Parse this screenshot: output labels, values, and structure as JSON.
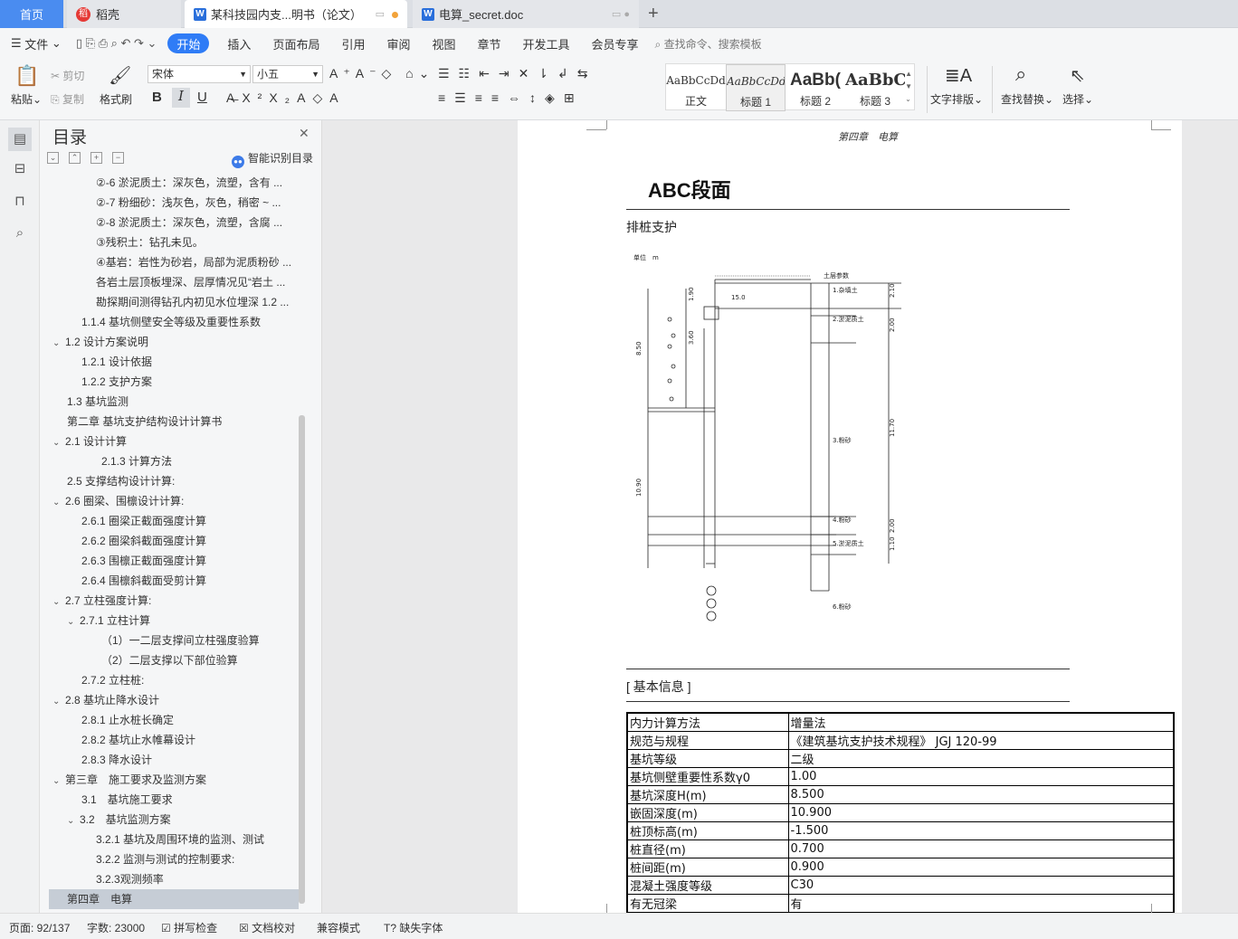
{
  "tabs": {
    "home": "首页",
    "daoke": "稻壳",
    "doc1": "某科技园内支...明书（论文）",
    "doc2": "电算_secret.doc",
    "add": "+"
  },
  "menu": {
    "file": "文件",
    "items": [
      "开始",
      "插入",
      "页面布局",
      "引用",
      "审阅",
      "视图",
      "章节",
      "开发工具",
      "会员专享"
    ],
    "search": "查找命令、搜索模板"
  },
  "ribbon": {
    "paste": "粘贴",
    "cut": "剪切",
    "copy": "复制",
    "format_painter": "格式刷",
    "font": "宋体",
    "size": "小五",
    "bold": "B",
    "italic": "I",
    "underline": "U",
    "text_layout": "文字排版",
    "find_replace": "查找替换",
    "select": "选择",
    "styles": [
      {
        "preview": "AaBbCcDd",
        "label": "正文"
      },
      {
        "preview": "AaBbCcDd",
        "label": "标题 1"
      },
      {
        "preview": "AaBb(",
        "label": "标题 2"
      },
      {
        "preview": "AaBbC",
        "label": "标题 3"
      }
    ]
  },
  "nav": {
    "title": "目录",
    "smart": "智能识别目录",
    "items": [
      {
        "t": "②-6 淤泥质土：深灰色，流塑，含有 ..."
      },
      {
        "t": "②-7 粉细砂：浅灰色，灰色，稍密 ~ ..."
      },
      {
        "t": "②-8 淤泥质土：深灰色，流塑，含腐 ..."
      },
      {
        "t": "③残积土：钻孔未见。"
      },
      {
        "t": "④基岩：岩性为砂岩，局部为泥质粉砂 ..."
      },
      {
        "t": "各岩土层顶板埋深、层厚情况见“岩土 ..."
      },
      {
        "t": "勘探期间测得钻孔内初见水位埋深 1.2 ..."
      },
      {
        "t": "1.1.4 基坑侧壁安全等级及重要性系数"
      },
      {
        "t": "1.2 设计方案说明"
      },
      {
        "t": "1.2.1 设计依据"
      },
      {
        "t": "1.2.2 支护方案"
      },
      {
        "t": "1.3 基坑监测"
      },
      {
        "t": "第二章 基坑支护结构设计计算书"
      },
      {
        "t": "2.1 设计计算"
      },
      {
        "t": "2.1.3 计算方法"
      },
      {
        "t": "2.5 支撑结构设计计算:"
      },
      {
        "t": "2.6 圈梁、围檩设计计算:"
      },
      {
        "t": "2.6.1 圈梁正截面强度计算"
      },
      {
        "t": "2.6.2 圈梁斜截面强度计算"
      },
      {
        "t": "2.6.3 围檩正截面强度计算"
      },
      {
        "t": "2.6.4 围檩斜截面受剪计算"
      },
      {
        "t": "2.7 立柱强度计算:"
      },
      {
        "t": "2.7.1 立柱计算"
      },
      {
        "t": "（1）一二层支撑间立柱强度验算"
      },
      {
        "t": "（2）二层支撑以下部位验算"
      },
      {
        "t": "2.7.2 立柱桩:"
      },
      {
        "t": "2.8 基坑止降水设计"
      },
      {
        "t": "2.8.1 止水桩长确定"
      },
      {
        "t": "2.8.2 基坑止水帷幕设计"
      },
      {
        "t": "2.8.3 降水设计"
      },
      {
        "t": "第三章　施工要求及监测方案"
      },
      {
        "t": "3.1　基坑施工要求"
      },
      {
        "t": "3.2　基坑监测方案"
      },
      {
        "t": "3.2.1 基坑及周围环境的监测、测试"
      },
      {
        "t": "3.2.2 监测与测试的控制要求:"
      },
      {
        "t": "3.2.3观测频率"
      },
      {
        "t": "第四章　电算"
      }
    ]
  },
  "doc": {
    "header": "第四章　电算",
    "title": "ABC段面",
    "sub": "排桩支护",
    "basic": "[ 基本信息 ]",
    "table": [
      [
        "内力计算方法",
        "增量法"
      ],
      [
        "规范与规程",
        "《建筑基坑支护技术规程》 JGJ 120-99"
      ],
      [
        "基坑等级",
        "二级"
      ],
      [
        "基坑侧壁重要性系数γ0",
        "1.00"
      ],
      [
        "基坑深度H(m)",
        "8.500"
      ],
      [
        "嵌固深度(m)",
        "10.900"
      ],
      [
        "桩顶标高(m)",
        "-1.500"
      ],
      [
        "桩直径(m)",
        "0.700"
      ],
      [
        "桩间距(m)",
        "0.900"
      ],
      [
        "混凝土强度等级",
        "C30"
      ],
      [
        "有无冠梁",
        "有"
      ]
    ],
    "fig": {
      "unit": "单位　m",
      "dims": [
        "1.90",
        "3.60",
        "8.50",
        "10.90",
        "2.10",
        "2.00",
        "11.70",
        "2.00",
        "1.10"
      ],
      "layers": [
        "1.杂填土",
        "2.淤泥质土",
        "3.粉砂",
        "4.粉砂",
        "5.淤泥质土",
        "6.粉砂"
      ],
      "load": "15.0",
      "top": "土层参数"
    }
  },
  "status": {
    "page": "页面: 92/137",
    "words": "字数: 23000",
    "spell": "拼写检查",
    "proof": "文档校对",
    "compat": "兼容模式",
    "font": "缺失字体"
  }
}
